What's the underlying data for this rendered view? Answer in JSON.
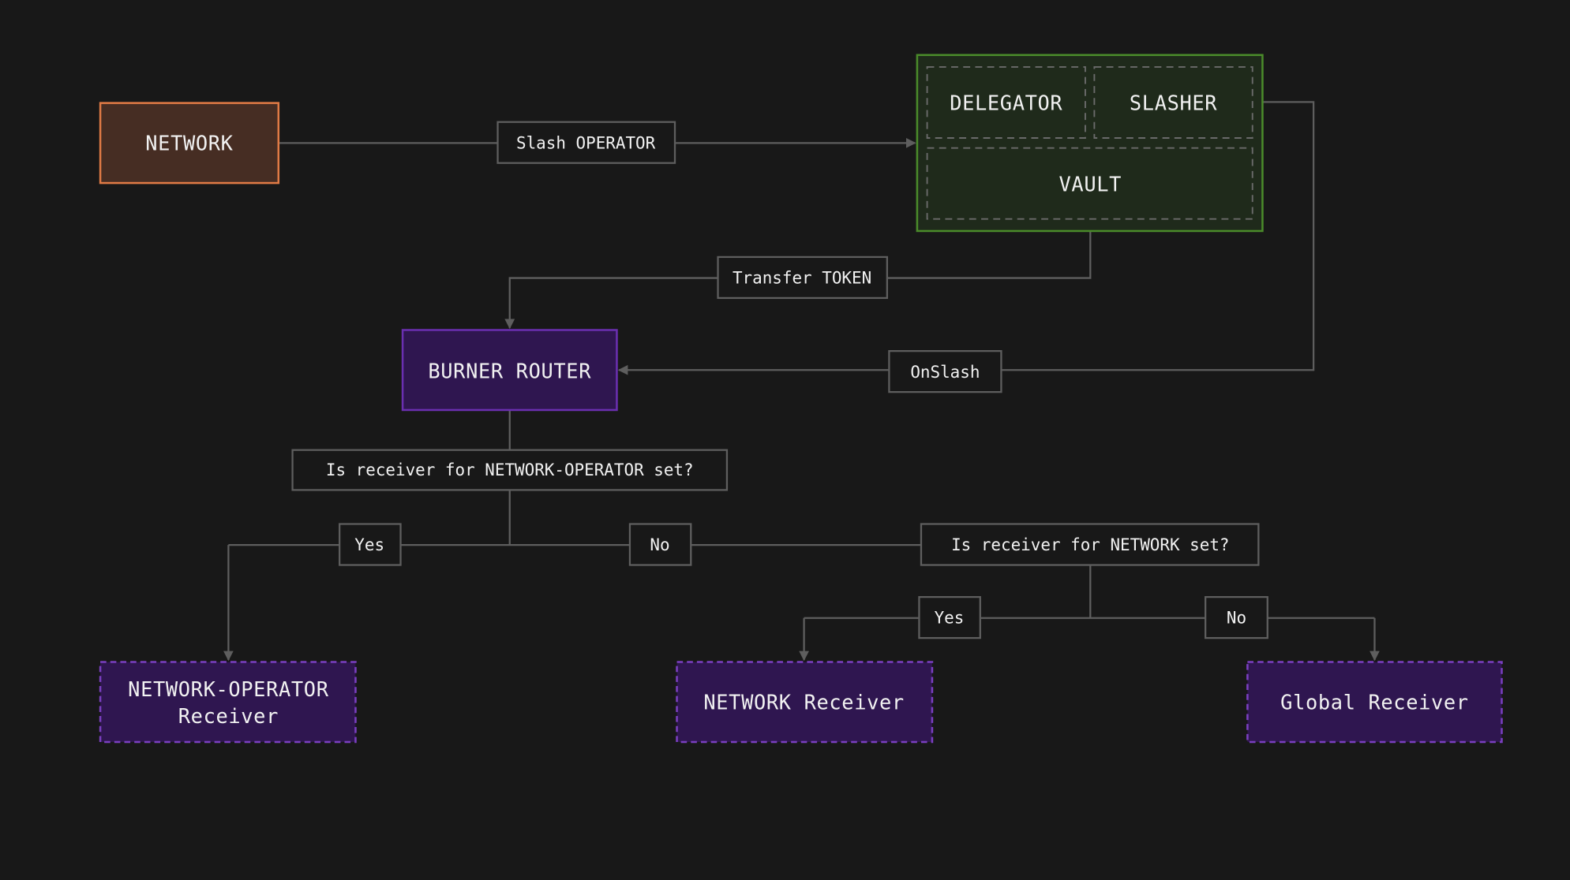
{
  "colors": {
    "background": "#181818",
    "network_fill": "#462d23",
    "network_stroke": "#e07a45",
    "vault_fill": "#1f2a1b",
    "vault_stroke": "#4a8a2a",
    "router_fill": "#2f1650",
    "router_stroke": "#6a2fb0",
    "edge": "#5e5e5e"
  },
  "nodes": {
    "network": "NETWORK",
    "delegator": "DELEGATOR",
    "slasher": "SLASHER",
    "vault": "VAULT",
    "burner_router": "BURNER ROUTER",
    "network_operator_receiver": [
      "NETWORK-OPERATOR",
      "Receiver"
    ],
    "network_receiver": "NETWORK Receiver",
    "global_receiver": "Global Receiver"
  },
  "edges": {
    "slash_operator": "Slash OPERATOR",
    "transfer_token": "Transfer TOKEN",
    "on_slash": "OnSlash",
    "question_network_operator": "Is receiver for NETWORK-OPERATOR set?",
    "yes_1": "Yes",
    "no_1": "No",
    "question_network": "Is receiver for NETWORK set?",
    "yes_2": "Yes",
    "no_2": "No"
  }
}
